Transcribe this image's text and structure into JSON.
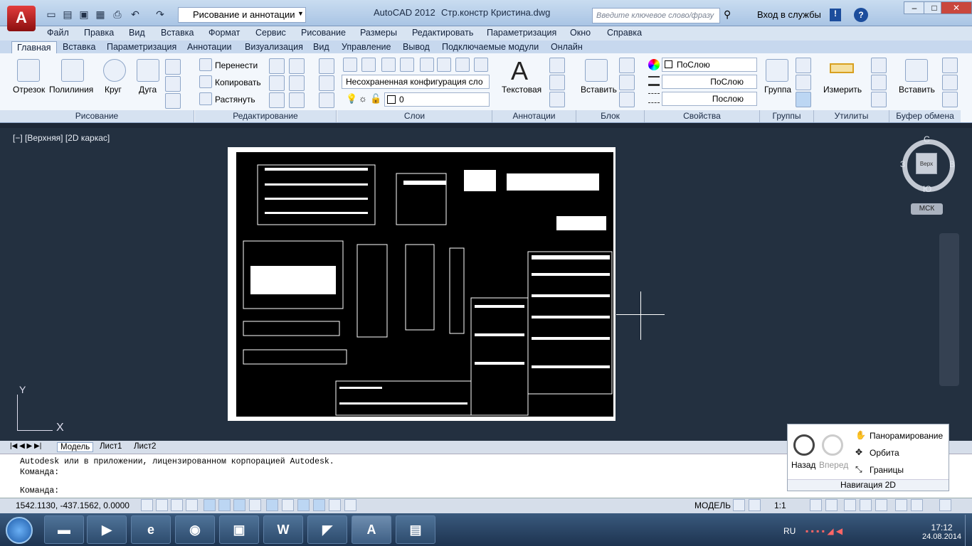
{
  "title": {
    "app": "AutoCAD 2012",
    "file": "Стр.констр Кристина.dwg",
    "workspace": "Рисование и аннотации",
    "search_placeholder": "Введите ключевое слово/фразу",
    "signin": "Вход в службы",
    "logo": "A"
  },
  "menus": [
    "Файл",
    "Правка",
    "Вид",
    "Вставка",
    "Формат",
    "Сервис",
    "Рисование",
    "Размеры",
    "Редактировать",
    "Параметризация",
    "Окно",
    "Справка"
  ],
  "tabs": [
    "Главная",
    "Вставка",
    "Параметризация",
    "Аннотации",
    "Визуализация",
    "Вид",
    "Управление",
    "Вывод",
    "Подключаемые модули",
    "Онлайн"
  ],
  "draw": {
    "line": "Отрезок",
    "polyline": "Полилиния",
    "circle": "Круг",
    "arc": "Дуга",
    "title": "Рисование"
  },
  "modify": {
    "move": "Перенести",
    "copy": "Копировать",
    "stretch": "Растянуть",
    "title": "Редактирование"
  },
  "layers": {
    "state": "Несохраненная конфигурация сло",
    "current": "0",
    "title": "Слои"
  },
  "annotation": {
    "text": "Текстовая",
    "title": "Аннотации"
  },
  "block": {
    "insert": "Вставить",
    "title": "Блок"
  },
  "properties": {
    "color": "ПоСлою",
    "lineweight": "ПоСлою",
    "linetype": "Послою",
    "title": "Свойства"
  },
  "groups": {
    "group": "Группа",
    "title": "Группы"
  },
  "utilities": {
    "measure": "Измерить",
    "title": "Утилиты"
  },
  "clipboard": {
    "paste": "Вставить",
    "title": "Буфер обмена"
  },
  "viewport": {
    "label": "[−] [Верхняя] [2D каркас]",
    "cube_top": "Верх",
    "n": "С",
    "s": "Ю",
    "w": "З",
    "e": "В",
    "ucs": "МСК",
    "ucs_x": "X",
    "ucs_y": "Y"
  },
  "layouts": [
    "Модель",
    "Лист1",
    "Лист2"
  ],
  "command": {
    "line1": "Autodesk или в приложении, лицензированном корпорацией Autodesk.",
    "line2": "Команда:",
    "line3": "Команда:"
  },
  "status": {
    "coords": "1542.1130, -437.1562, 0.0000",
    "model": "МОДЕЛЬ",
    "scale": "1:1"
  },
  "nav2d": {
    "back": "Назад",
    "forward": "Вперед",
    "pan": "Панорамирование",
    "orbit": "Орбита",
    "extents": "Границы",
    "title": "Навигация 2D"
  },
  "tray": {
    "lang": "RU",
    "time": "17:12",
    "date": "24.08.2014"
  }
}
